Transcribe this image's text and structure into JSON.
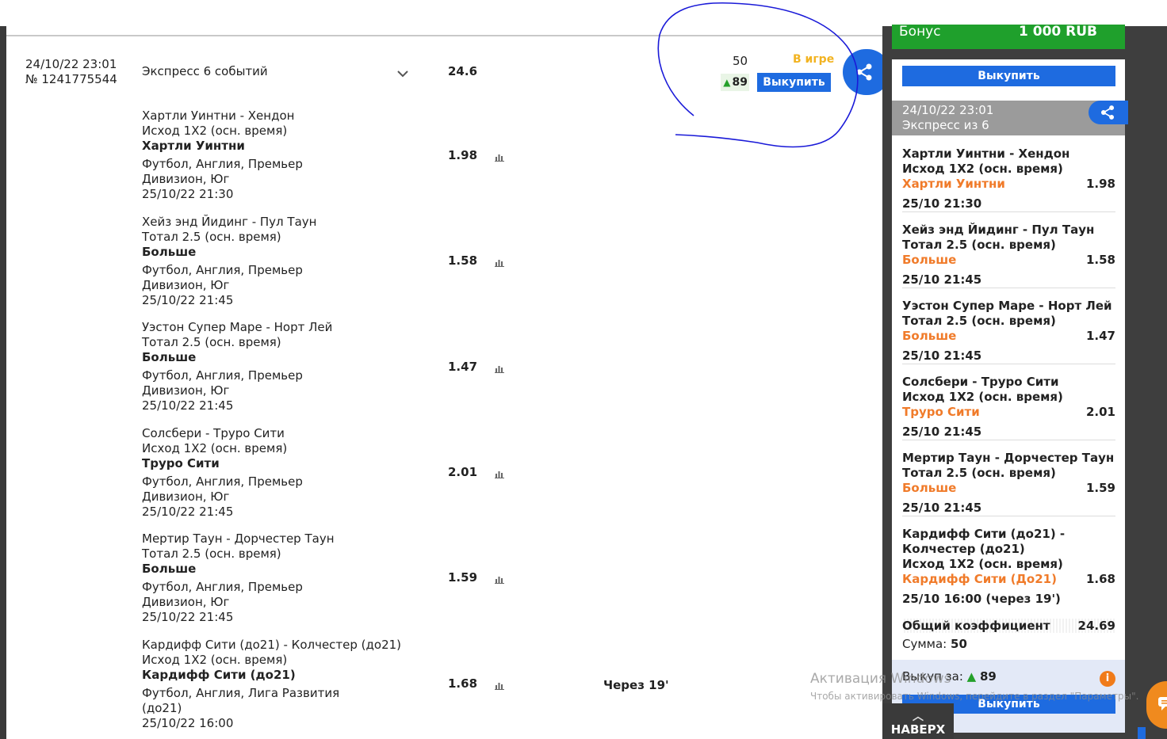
{
  "header": {
    "date": "24/10/22 23:01",
    "number": "№ 1241775544",
    "title": "Экспресс 6 событий",
    "coef": "24.6",
    "stake": "50",
    "state": "В игре",
    "cashout_value": "89",
    "cashout_button": "Выкупить"
  },
  "events": [
    {
      "match": "Хартли Уинтни - Хендон",
      "market": "Исход 1X2 (осн. время)",
      "selection": "Хартли Уинтни",
      "info": "Футбол, Англия, Премьер\nДивизион, Юг\n25/10/22 21:30",
      "coef": "1.98"
    },
    {
      "match": "Хейз энд Йидинг - Пул Таун",
      "market": "Тотал 2.5 (осн. время)",
      "selection": "Больше",
      "info": "Футбол, Англия, Премьер\nДивизион, Юг\n25/10/22 21:45",
      "coef": "1.58"
    },
    {
      "match": "Уэстон Супер Маре - Норт Лей",
      "market": "Тотал 2.5 (осн. время)",
      "selection": "Больше",
      "info": "Футбол, Англия, Премьер\nДивизион, Юг\n25/10/22 21:45",
      "coef": "1.47"
    },
    {
      "match": "Солсбери - Труро Сити",
      "market": "Исход 1X2 (осн. время)",
      "selection": "Труро Сити",
      "info": "Футбол, Англия, Премьер\nДивизион, Юг\n25/10/22 21:45",
      "coef": "2.01"
    },
    {
      "match": "Мертир Таун - Дорчестер Таун",
      "market": "Тотал 2.5 (осн. время)",
      "selection": "Больше",
      "info": "Футбол, Англия, Премьер\nДивизион, Юг\n25/10/22 21:45",
      "coef": "1.59"
    },
    {
      "match": "Кардифф Сити (до21) - Колчестер (до21)",
      "market": "Исход 1X2 (осн. время)",
      "selection": "Кардифф Сити (до21)",
      "info": "Футбол, Англия, Лига Развития\n(до21)\n25/10/22 16:00",
      "coef": "1.68"
    }
  ],
  "through": "Через 19'",
  "sidebar": {
    "bonus_label": "Бонус",
    "bonus_amount": "1 000 RUB",
    "buy_button": "Выкупить",
    "head_date": "24/10/22 23:01",
    "head_title": "Экспресс из 6",
    "bets": [
      {
        "match": "Хартли Уинтни - Хендон",
        "market": "Исход 1X2 (осн. время)",
        "selection": "Хартли Уинтни",
        "coef": "1.98",
        "date": "25/10 21:30"
      },
      {
        "match": "Хейз энд Йидинг - Пул Таун",
        "market": "Тотал 2.5 (осн. время)",
        "selection": "Больше",
        "coef": "1.58",
        "date": "25/10 21:45"
      },
      {
        "match": "Уэстон Супер Маре - Норт Лей",
        "market": "Тотал 2.5 (осн. время)",
        "selection": "Больше",
        "coef": "1.47",
        "date": "25/10 21:45"
      },
      {
        "match": "Солсбери - Труро Сити",
        "market": "Исход 1X2 (осн. время)",
        "selection": "Труро Сити",
        "coef": "2.01",
        "date": "25/10 21:45"
      },
      {
        "match": "Мертир Таун - Дорчестер Таун",
        "market": "Тотал 2.5 (осн. время)",
        "selection": "Больше",
        "coef": "1.59",
        "date": "25/10 21:45"
      },
      {
        "match": "Кардифф Сити (до21) - Колчестер (до21)",
        "market": "Исход 1X2 (осн. время)",
        "selection": "Кардифф Сити (До21)",
        "coef": "1.68",
        "date": "25/10 16:00 (через 19')"
      }
    ],
    "total_label": "Общий коэффициент",
    "total_value": "24.69",
    "sum_label": "Сумма:",
    "sum_value": "50",
    "buyout_label": "Выкуп за:",
    "buyout_value": "89",
    "buy_button2": "Выкупить"
  },
  "watermark": {
    "line1": "Активация Windows",
    "line2": "Чтобы активировать Windows, перейдите в раздел \"Параметры\"."
  },
  "scroll_top": "НАВЕРХ",
  "colors": {
    "accent_blue": "#1e6be0",
    "bonus_green": "#1fa02c",
    "selection_orange": "#f07b2a",
    "state_yellow": "#f2b321",
    "annotation": "#1a1ad8"
  },
  "icons": [
    "share-icon",
    "chevron-down-icon",
    "stats-icon",
    "arrow-up-icon",
    "info-icon",
    "chat-icon"
  ]
}
